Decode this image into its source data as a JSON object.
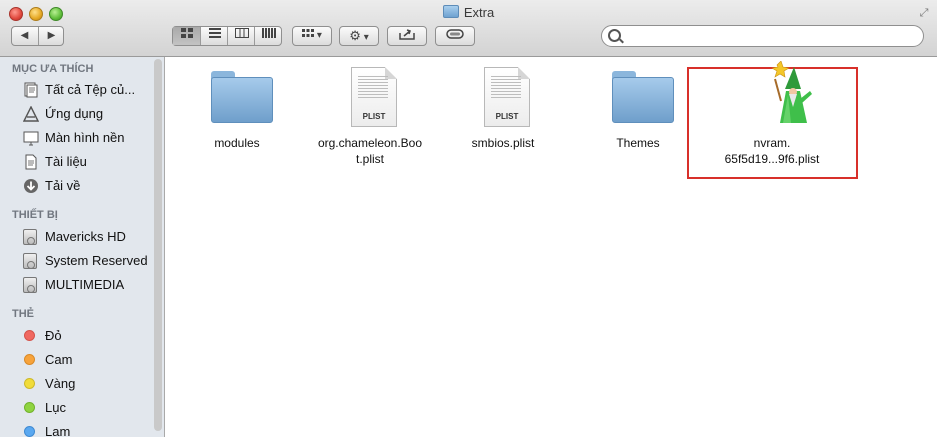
{
  "window": {
    "title": "Extra"
  },
  "toolbar": {
    "back_symbol": "◀",
    "forward_symbol": "▶",
    "views": [
      "icon-view",
      "list-view",
      "column-view",
      "coverflow-view"
    ],
    "arrange_label": "▾",
    "action_label": "▾",
    "search": {
      "value": "",
      "placeholder": ""
    }
  },
  "sidebar": {
    "sections": [
      {
        "title": "MỤC ƯA THÍCH",
        "items": [
          {
            "label": "Tất cả Tệp củ...",
            "icon": "all-files-icon"
          },
          {
            "label": "Ứng dụng",
            "icon": "applications-icon"
          },
          {
            "label": "Màn hình nền",
            "icon": "desktop-icon"
          },
          {
            "label": "Tài liệu",
            "icon": "documents-icon"
          },
          {
            "label": "Tải về",
            "icon": "downloads-icon"
          }
        ]
      },
      {
        "title": "THIẾT BỊ",
        "items": [
          {
            "label": "Mavericks HD",
            "icon": "drive-icon"
          },
          {
            "label": "System Reserved",
            "icon": "drive-icon"
          },
          {
            "label": "MULTIMEDIA",
            "icon": "drive-icon"
          }
        ]
      },
      {
        "title": "THẺ",
        "items": [
          {
            "label": "Đỏ",
            "color": "#f06860"
          },
          {
            "label": "Cam",
            "color": "#f7a33b"
          },
          {
            "label": "Vàng",
            "color": "#f1dc3a"
          },
          {
            "label": "Lục",
            "color": "#8fd440"
          },
          {
            "label": "Lam",
            "color": "#5aa8f0"
          }
        ]
      }
    ]
  },
  "files": [
    {
      "name": "modules",
      "kind": "folder"
    },
    {
      "name": "org.chameleon.Boo t.plist",
      "line1": "org.chameleon.Boo",
      "line2": "t.plist",
      "kind": "plist",
      "badge": "PLIST"
    },
    {
      "name": "smbios.plist",
      "kind": "plist",
      "badge": "PLIST"
    },
    {
      "name": "Themes",
      "kind": "folder"
    },
    {
      "name": "nvram. 65f5d19...9f6.plist",
      "line1": "nvram.",
      "line2": "65f5d19...9f6.plist",
      "kind": "wizard",
      "selected": true
    }
  ],
  "colors": {
    "highlight": "#d8302a",
    "sidebar_bg": "#e2e7ed"
  }
}
